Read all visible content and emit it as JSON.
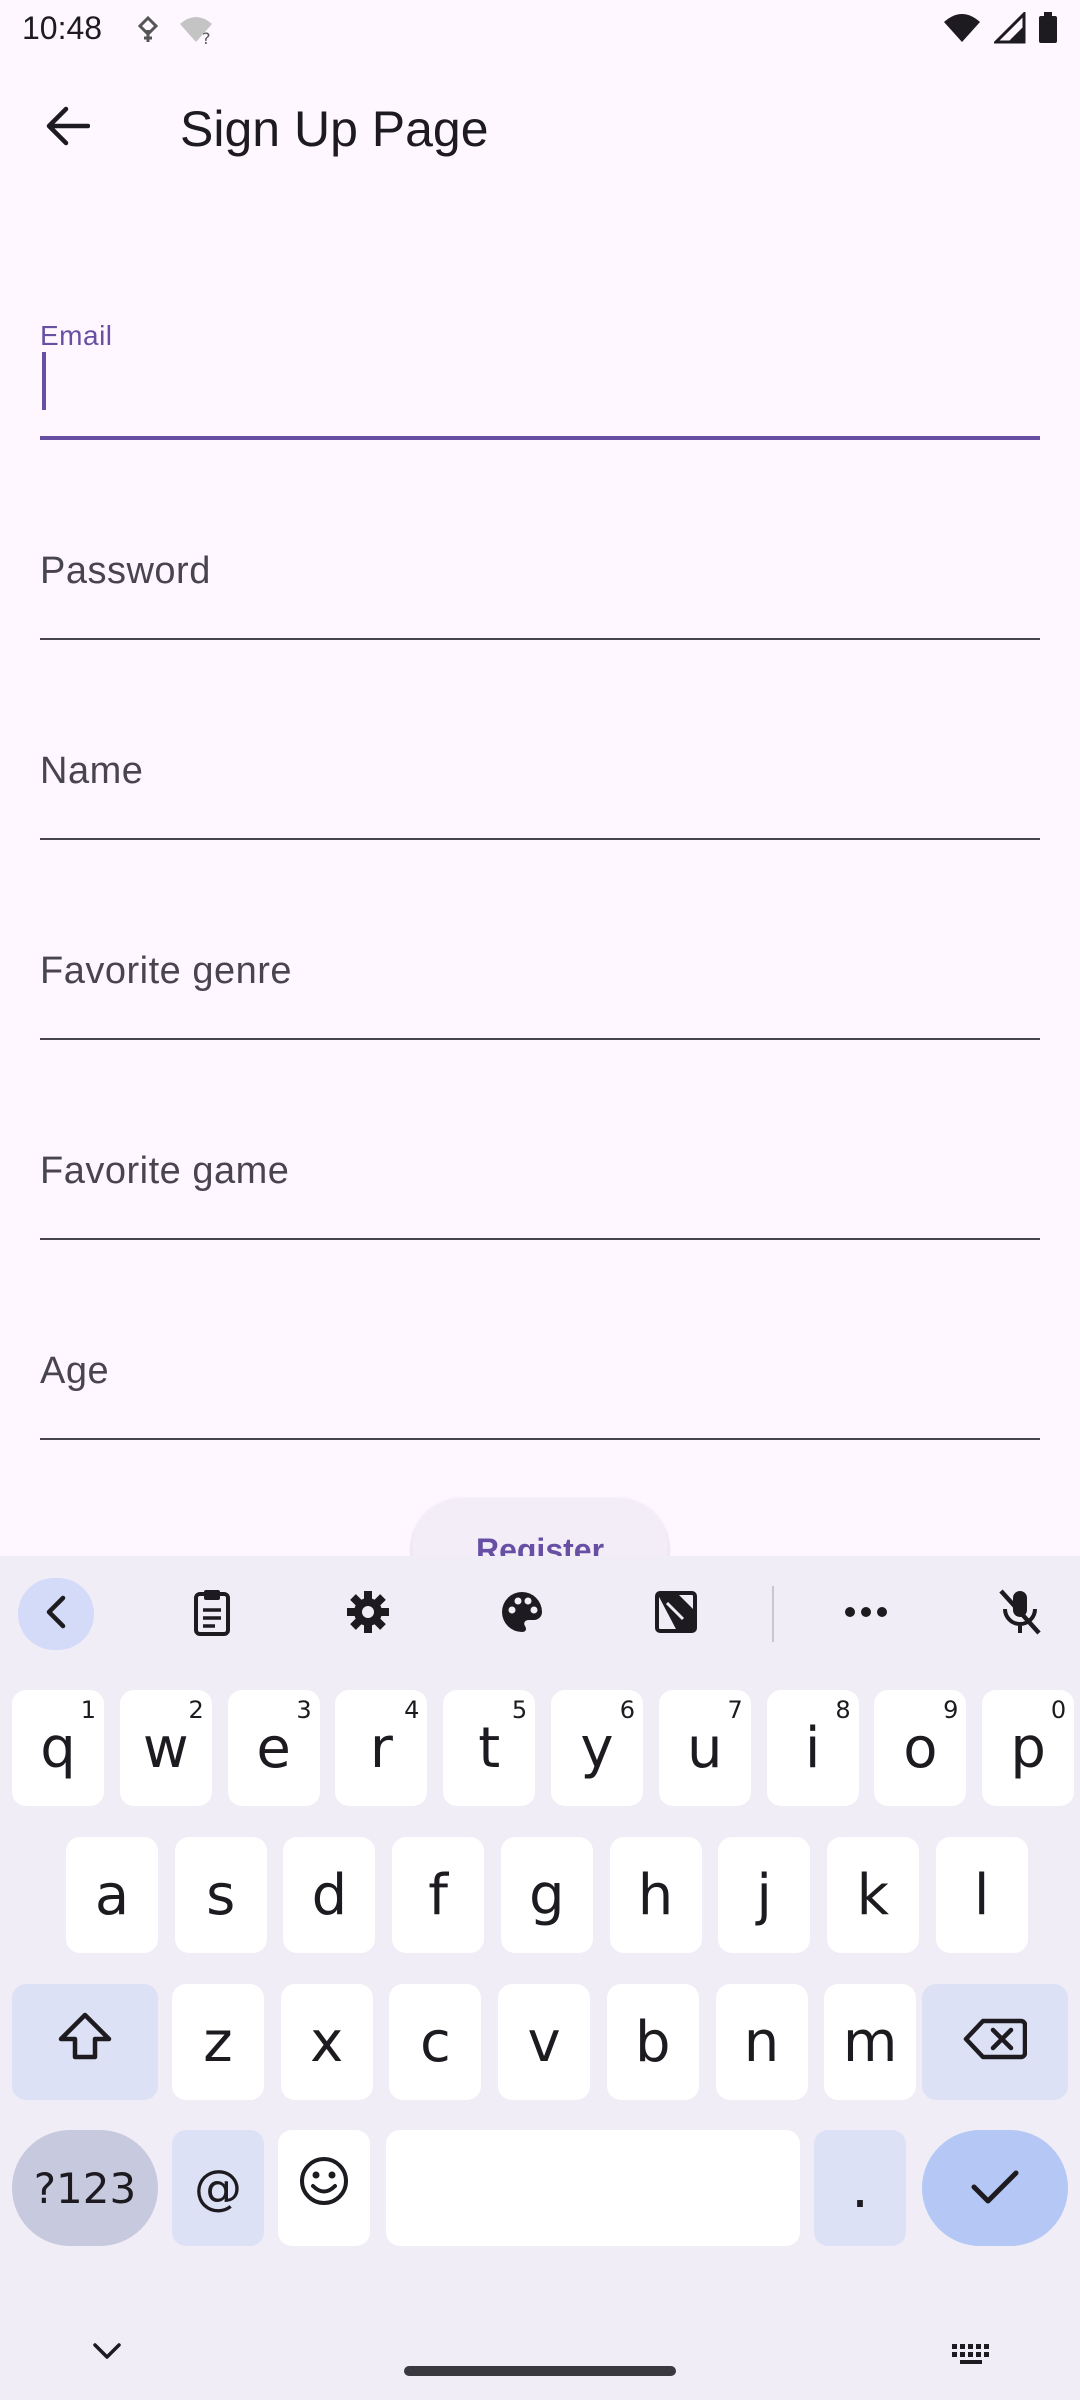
{
  "status_bar": {
    "time": "10:48",
    "left_icons": [
      "vpn-key-icon",
      "wifi-question-icon"
    ],
    "right_icons": [
      "wifi-icon",
      "signal-icon",
      "battery-icon"
    ]
  },
  "app_bar": {
    "back_icon": "arrow-back-icon",
    "title": "Sign Up Page"
  },
  "form": {
    "email": {
      "label": "Email",
      "value": ""
    },
    "password": {
      "label": "Password",
      "value": ""
    },
    "name": {
      "label": "Name",
      "value": ""
    },
    "genre": {
      "label": "Favorite genre",
      "value": ""
    },
    "game": {
      "label": "Favorite game",
      "value": ""
    },
    "age": {
      "label": "Age",
      "value": ""
    },
    "register_label": "Register"
  },
  "keyboard": {
    "toolbar": [
      "collapse-icon",
      "clipboard-icon",
      "settings-icon",
      "palette-icon",
      "resize-icon",
      "more-icon",
      "mic-off-icon"
    ],
    "row1": [
      {
        "k": "q",
        "h": "1"
      },
      {
        "k": "w",
        "h": "2"
      },
      {
        "k": "e",
        "h": "3"
      },
      {
        "k": "r",
        "h": "4"
      },
      {
        "k": "t",
        "h": "5"
      },
      {
        "k": "y",
        "h": "6"
      },
      {
        "k": "u",
        "h": "7"
      },
      {
        "k": "i",
        "h": "8"
      },
      {
        "k": "o",
        "h": "9"
      },
      {
        "k": "p",
        "h": "0"
      }
    ],
    "row2": [
      "a",
      "s",
      "d",
      "f",
      "g",
      "h",
      "j",
      "k",
      "l"
    ],
    "row3": [
      "z",
      "x",
      "c",
      "v",
      "b",
      "n",
      "m"
    ],
    "sym_label": "?123",
    "at_label": "@",
    "period_label": "."
  },
  "colors": {
    "accent": "#6750a4",
    "background": "#fef7ff",
    "keyboard_bg": "#f0edf6"
  }
}
